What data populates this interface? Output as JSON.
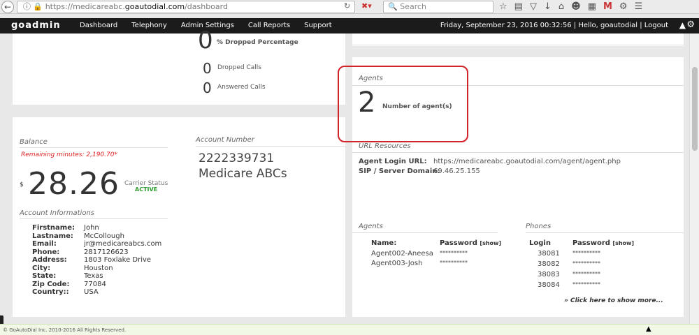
{
  "browser": {
    "url_prefix": "https://medicareabc.",
    "url_domain": "goautodial.com",
    "url_path": "/dashboard",
    "search_placeholder": "Search"
  },
  "app": {
    "logo": "goadmin",
    "nav": [
      "Dashboard",
      "Telephony",
      "Admin Settings",
      "Call Reports",
      "Support"
    ],
    "status": "Friday, September 23, 2016 00:32:56 | Hello, goautodial | Logout"
  },
  "calls": {
    "dropped_pct_value": "0",
    "dropped_pct_label": "% Dropped Percentage",
    "dropped_value": "0",
    "dropped_label": "Dropped Calls",
    "answered_value": "0",
    "answered_label": "Answered Calls"
  },
  "balance": {
    "title": "Balance",
    "remaining": "Remaining minutes: 2,190.70*",
    "currency": "$",
    "amount": "28.26",
    "carrier_label": "Carrier Status",
    "carrier_value": "ACTIVE"
  },
  "account_number": {
    "title": "Account Number",
    "number": "2222339731",
    "name": "Medicare ABCs"
  },
  "account_info": {
    "title": "Account Informations",
    "rows": [
      {
        "k": "Firstname:",
        "v": "John"
      },
      {
        "k": "Lastname:",
        "v": "McCollough"
      },
      {
        "k": "Email:",
        "v": "jr@medicareabcs.com"
      },
      {
        "k": "Phone:",
        "v": "2817126623"
      },
      {
        "k": "Address:",
        "v": "1803 Foxlake Drive"
      },
      {
        "k": "City:",
        "v": "Houston"
      },
      {
        "k": "State:",
        "v": "Texas"
      },
      {
        "k": "Zip Code:",
        "v": "77084"
      },
      {
        "k": "Country::",
        "v": "USA"
      }
    ]
  },
  "agents_summary": {
    "title": "Agents",
    "count": "2",
    "label": "Number of agent(s)"
  },
  "url_resources": {
    "title": "URL Resources",
    "login_label": "Agent Login URL:",
    "login_value": "https://medicareabc.goautodial.com/agent/agent.php",
    "sip_label": "SIP / Server Domain:",
    "sip_value": "69.46.25.155"
  },
  "agents_table": {
    "title": "Agents",
    "col_name": "Name:",
    "col_password": "Password",
    "show": "[show]",
    "rows": [
      {
        "name": "Agent002-Aneesa",
        "password": "**********"
      },
      {
        "name": "Agent003-Josh",
        "password": "**********"
      }
    ]
  },
  "phones_table": {
    "title": "Phones",
    "col_login": "Login",
    "col_password": "Password",
    "show": "[show]",
    "rows": [
      {
        "login": "38081",
        "password": "**********"
      },
      {
        "login": "38082",
        "password": "**********"
      },
      {
        "login": "38083",
        "password": "**********"
      },
      {
        "login": "38084",
        "password": "**********"
      }
    ],
    "show_more": "» Click here to show more..."
  },
  "footer": {
    "copyright": "© GoAutoDial Inc. 2010-2016 All Rights Reserved."
  },
  "colors": {
    "accent_red": "#d2232a",
    "active_green": "#2e9a2e",
    "nav_bg": "#1b1b1b"
  }
}
